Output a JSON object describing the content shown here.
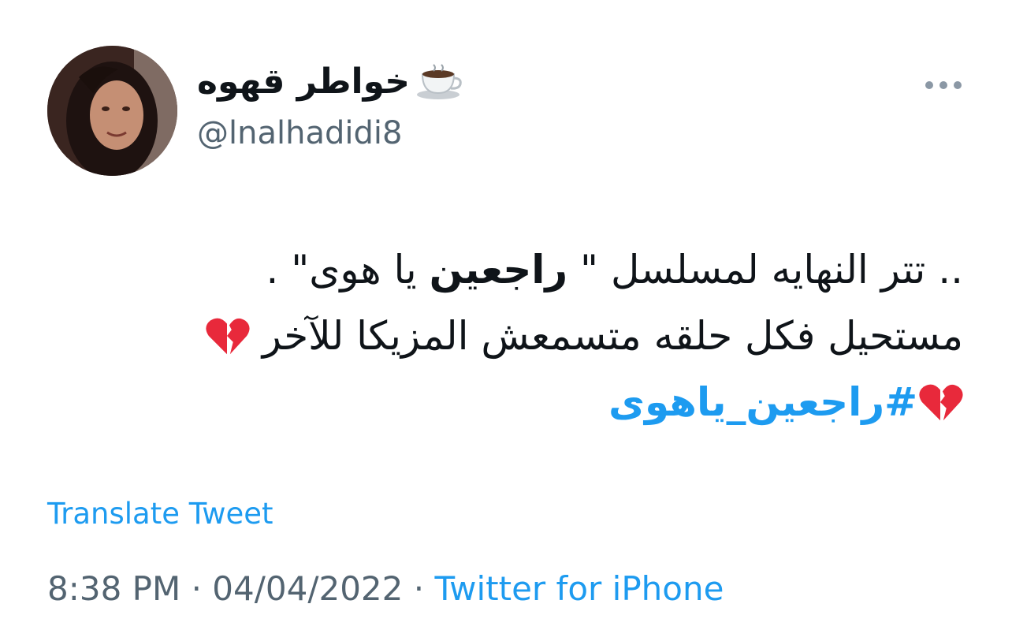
{
  "author": {
    "display_name": "خواطر قهوه",
    "display_emoji_icon": "coffee-cup-icon",
    "handle": "@lnalhadidi8"
  },
  "tweet": {
    "line1_pre": ".. تتر النهايه لمسلسل \" ",
    "line1_bold": "راجعين",
    "line1_post": " يا هوى\" .",
    "line2": "مستحيل فكل حلقه متسمعش المزيكا للآخر",
    "line2_emoji_icon": "broken-heart-icon",
    "hashtag": "#راجعين_ياهوى",
    "line3_emoji_icon": "broken-heart-icon"
  },
  "translate_label": "Translate Tweet",
  "meta": {
    "time": "8:38 PM",
    "separator1": " · ",
    "date": "04/04/2022",
    "separator2": " · ",
    "source": "Twitter for iPhone"
  },
  "colors": {
    "link": "#1d9bf0",
    "secondary": "#536471",
    "text": "#0f1419"
  }
}
